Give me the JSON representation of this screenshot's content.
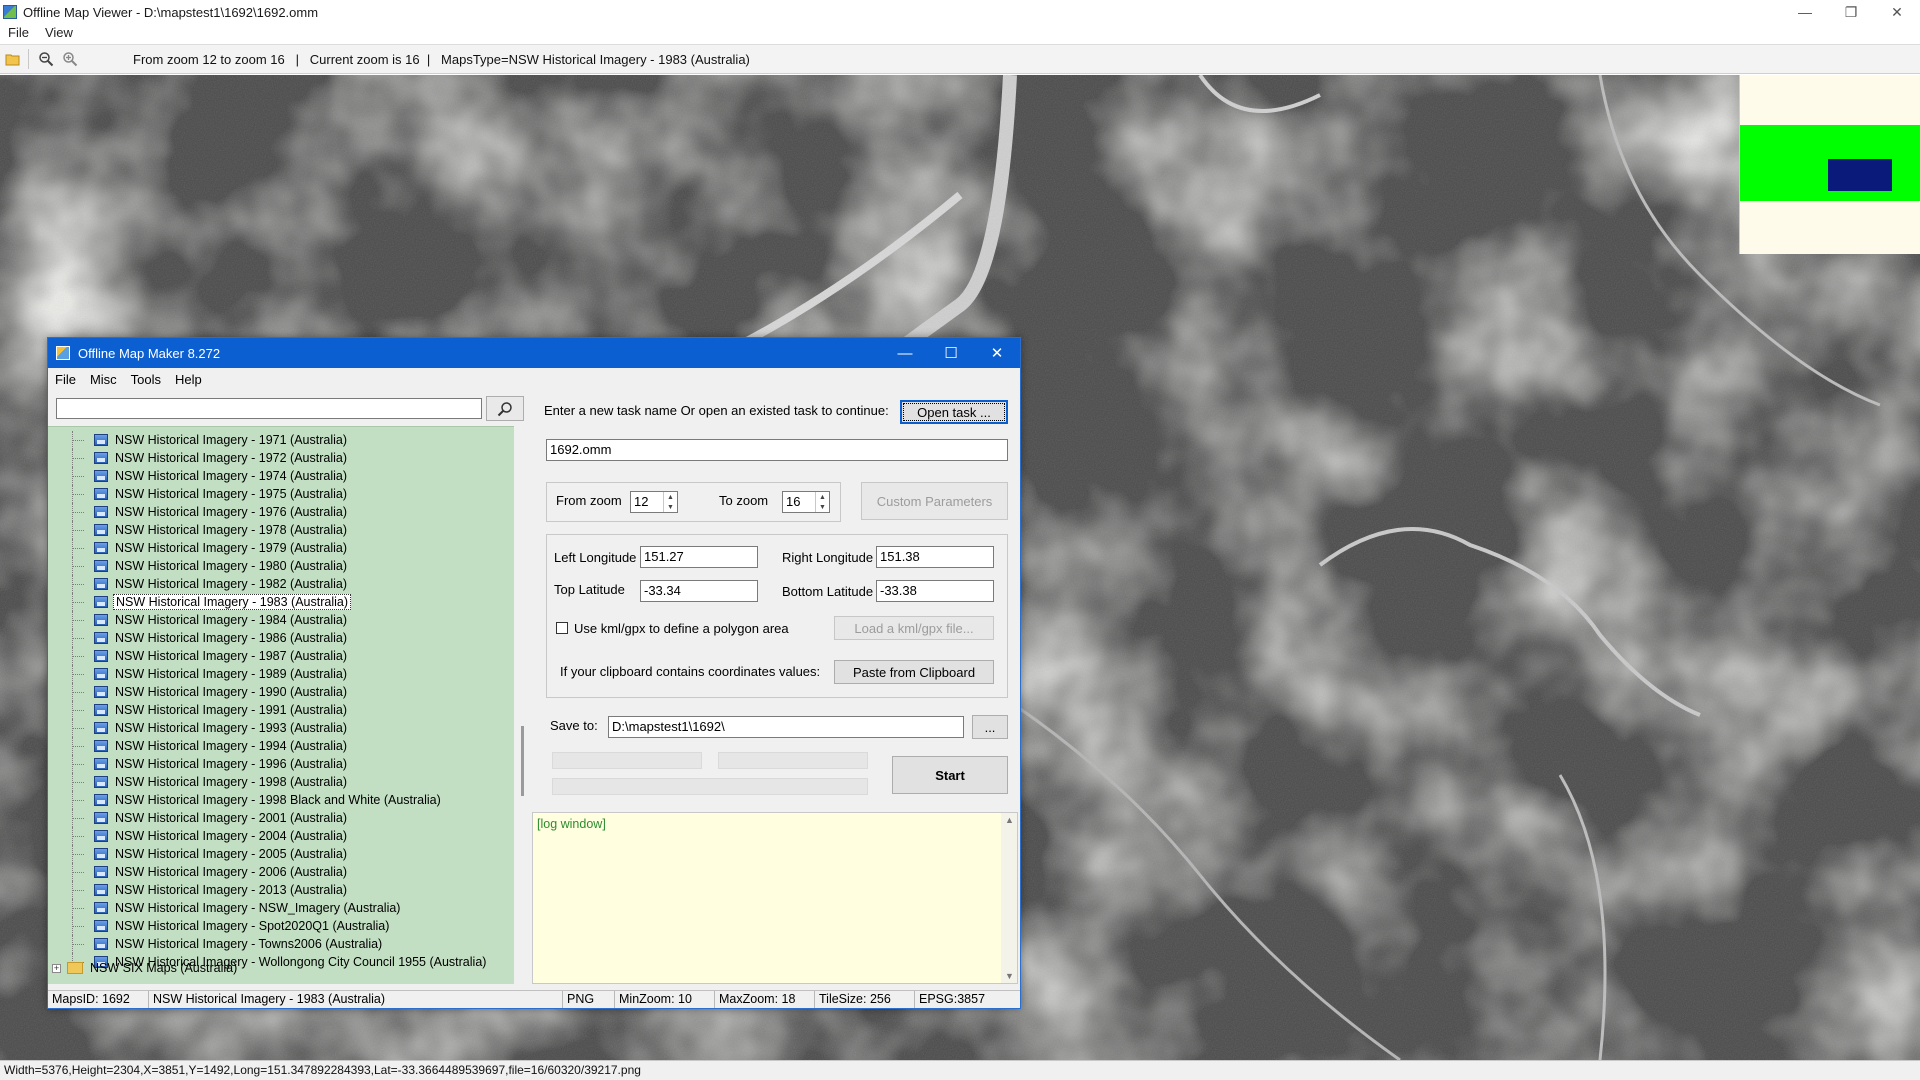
{
  "viewer": {
    "title": "Offline Map Viewer - D:\\mapstest1\\1692\\1692.omm",
    "menu": [
      "File",
      "View"
    ],
    "toolbar_info": "From zoom 12 to zoom 16   |   Current zoom is 16  |   MapsType=NSW Historical Imagery - 1983 (Australia)",
    "status": "Width=5376,Height=2304,X=3851,Y=1492,Long=151.347892284393,Lat=-33.3664489539697,file=16/60320/39217.png",
    "ctrls": [
      "—",
      "❐",
      "✕"
    ]
  },
  "dialog": {
    "title": "Offline Map Maker 8.272",
    "ctrls": [
      "—",
      "☐",
      "✕"
    ],
    "menu": [
      "File",
      "Misc",
      "Tools",
      "Help"
    ],
    "search_placeholder": "",
    "tree_items": [
      "NSW Historical Imagery - 1971 (Australia)",
      "NSW Historical Imagery - 1972 (Australia)",
      "NSW Historical Imagery - 1974 (Australia)",
      "NSW Historical Imagery - 1975 (Australia)",
      "NSW Historical Imagery - 1976 (Australia)",
      "NSW Historical Imagery - 1978 (Australia)",
      "NSW Historical Imagery - 1979 (Australia)",
      "NSW Historical Imagery - 1980 (Australia)",
      "NSW Historical Imagery - 1982 (Australia)",
      "NSW Historical Imagery - 1983 (Australia)",
      "NSW Historical Imagery - 1984 (Australia)",
      "NSW Historical Imagery - 1986 (Australia)",
      "NSW Historical Imagery - 1987 (Australia)",
      "NSW Historical Imagery - 1989 (Australia)",
      "NSW Historical Imagery - 1990 (Australia)",
      "NSW Historical Imagery - 1991 (Australia)",
      "NSW Historical Imagery - 1993 (Australia)",
      "NSW Historical Imagery - 1994 (Australia)",
      "NSW Historical Imagery - 1996 (Australia)",
      "NSW Historical Imagery - 1998 (Australia)",
      "NSW Historical Imagery - 1998 Black and White (Australia)",
      "NSW Historical Imagery - 2001 (Australia)",
      "NSW Historical Imagery - 2004 (Australia)",
      "NSW Historical Imagery - 2005 (Australia)",
      "NSW Historical Imagery - 2006 (Australia)",
      "NSW Historical Imagery - 2013 (Australia)",
      "NSW Historical Imagery - NSW_Imagery (Australia)",
      "NSW Historical Imagery - Spot2020Q1 (Australia)",
      "NSW Historical Imagery - Towns2006 (Australia)",
      "NSW Historical Imagery - Wollongong City Council 1955 (Australia)"
    ],
    "selected_item": "NSW Historical Imagery - 1983 (Australia)",
    "folder_item": "NSW SIX Maps (Australia)",
    "folder_expander": "+",
    "task_prompt": "Enter a new task name Or open an existed task to continue:",
    "open_task_label": "Open task ...",
    "task_name": "1692.omm",
    "from_zoom_label": "From zoom",
    "from_zoom": "12",
    "to_zoom_label": "To zoom",
    "to_zoom": "16",
    "custom_params_label": "Custom Parameters",
    "left_lon_label": "Left Longitude",
    "left_lon": "151.27",
    "right_lon_label": "Right Longitude",
    "right_lon": "151.38",
    "top_lat_label": "Top Latitude",
    "top_lat": "-33.34",
    "bottom_lat_label": "Bottom Latitude",
    "bottom_lat": "-33.38",
    "kml_label": "Use kml/gpx to define a polygon area",
    "load_kml_label": "Load a kml/gpx file...",
    "clipboard_prompt": "If your clipboard contains coordinates values:",
    "paste_label": "Paste from Clipboard",
    "save_to_label": "Save to:",
    "save_to": "D:\\mapstest1\\1692\\",
    "browse_label": "...",
    "start_label": "Start",
    "log_text": "[log window]",
    "status": {
      "maps_id": "MapsID: 1692",
      "map_name": "NSW Historical Imagery - 1983 (Australia)",
      "format": "PNG",
      "min_zoom": "MinZoom: 10",
      "max_zoom": "MaxZoom: 18",
      "tile_size": "TileSize: 256",
      "epsg": "EPSG:3857"
    }
  },
  "colors": {
    "overview_band": "#00ff00",
    "overview_rect": "#0a1a7a",
    "tree_bg": "#c3dfc3",
    "log_bg": "#ffffe0",
    "dialog_title": "#0c5fd1"
  }
}
